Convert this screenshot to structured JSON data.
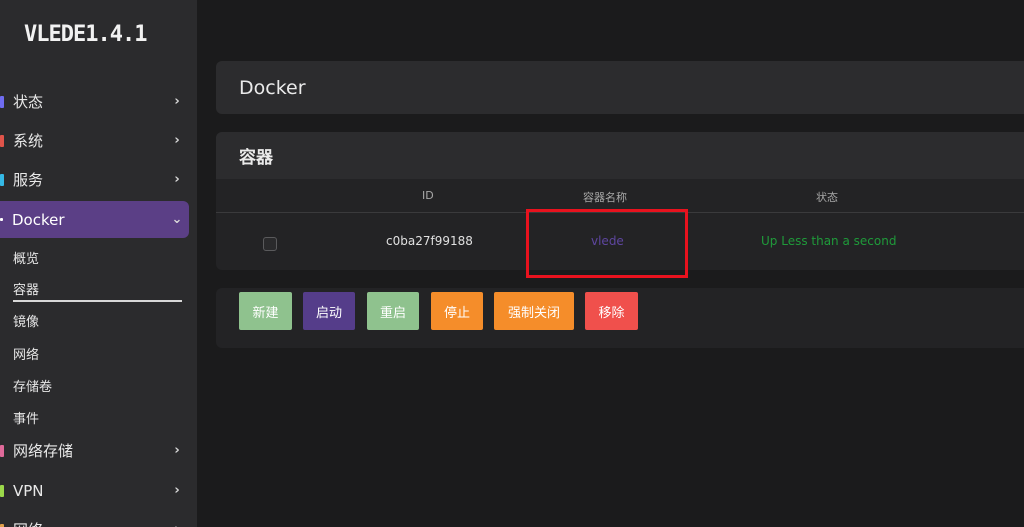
{
  "app": {
    "brand": "VLEDE1.4.1"
  },
  "sidebar": {
    "items": [
      {
        "label": "状态",
        "marker_color": "#6f6cf0"
      },
      {
        "label": "系统",
        "marker_color": "#e0544a"
      },
      {
        "label": "服务",
        "marker_color": "#35b9e6"
      },
      {
        "label": "Docker",
        "marker_color": "#ffffff"
      },
      {
        "label": "网络存储",
        "marker_color": "#e06a9a"
      },
      {
        "label": "VPN",
        "marker_color": "#9bd84a"
      },
      {
        "label": "网络",
        "marker_color": "#e0a04a"
      }
    ],
    "docker_submenu": [
      "概览",
      "容器",
      "镜像",
      "网络",
      "存储卷",
      "事件"
    ],
    "active_item": "Docker",
    "active_subitem": "容器"
  },
  "main": {
    "title": "Docker",
    "containers": {
      "heading": "容器",
      "columns": [
        "ID",
        "容器名称",
        "状态"
      ],
      "rows": [
        {
          "id": "c0ba27f99188",
          "name": "vlede",
          "status": "Up Less than a second"
        }
      ]
    },
    "buttons": [
      {
        "label": "新建",
        "color": "#8fc28e"
      },
      {
        "label": "启动",
        "color": "#553d8a"
      },
      {
        "label": "重启",
        "color": "#8fc28e"
      },
      {
        "label": "停止",
        "color": "#f58d2a"
      },
      {
        "label": "强制关闭",
        "color": "#f58d2a"
      },
      {
        "label": "移除",
        "color": "#f0504c"
      }
    ]
  }
}
